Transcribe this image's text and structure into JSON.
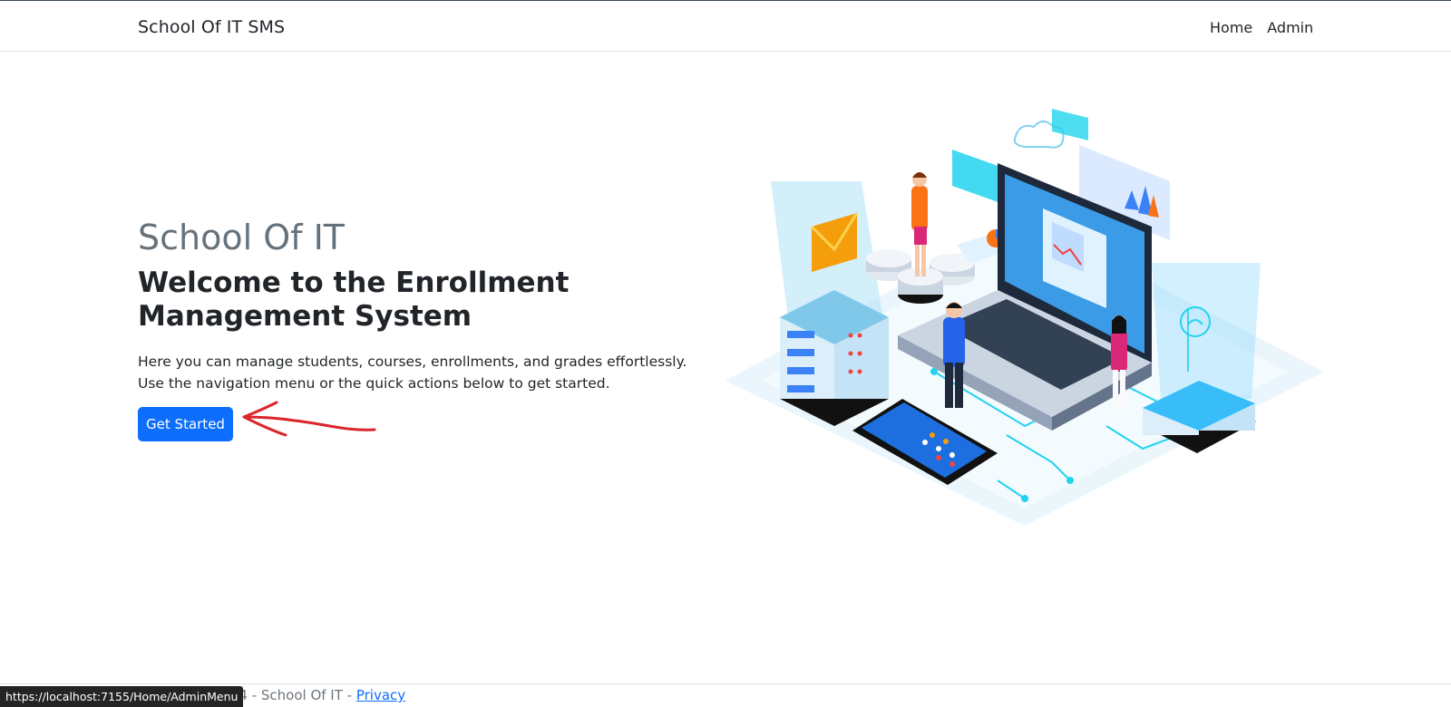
{
  "navbar": {
    "brand": "School Of IT SMS",
    "links": [
      "Home",
      "Admin"
    ]
  },
  "hero": {
    "title": "School Of IT",
    "subtitle": "Welcome to the Enrollment Management System",
    "description": "Here you can manage students, courses, enrollments, and grades effortlessly. Use the navigation menu or the quick actions below to get started.",
    "button_label": "Get Started"
  },
  "footer": {
    "text": "© 2024 - School Of IT - ",
    "link": "Privacy"
  },
  "status_bar": {
    "url": "https://localhost:7155/Home/AdminMenu"
  },
  "colors": {
    "primary": "#0d6efd",
    "title_gray": "#65727c",
    "annotation_red": "#d9262b",
    "illustration_cyan": "#22d3ee"
  }
}
